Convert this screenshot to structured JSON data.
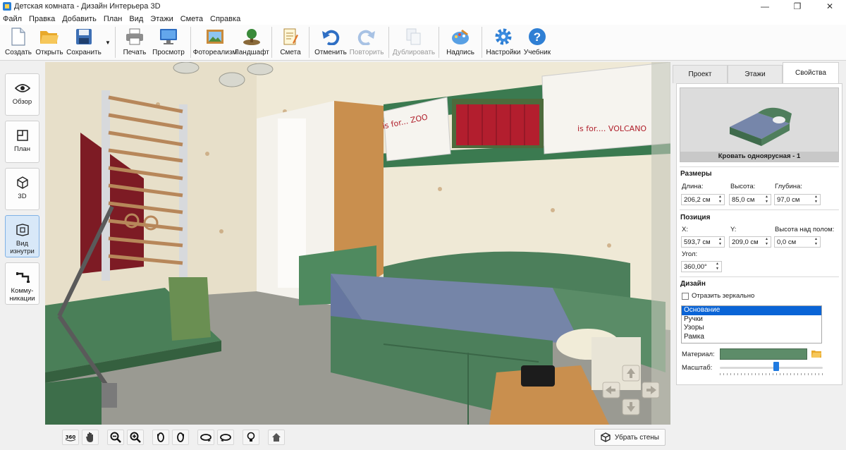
{
  "window": {
    "title": "Детская комната - Дизайн Интерьера 3D",
    "controls": [
      "minimize-icon",
      "maximize-icon",
      "close-icon"
    ]
  },
  "menu": [
    "Файл",
    "Правка",
    "Добавить",
    "План",
    "Вид",
    "Этажи",
    "Смета",
    "Справка"
  ],
  "toolbar": {
    "create": "Создать",
    "open": "Открыть",
    "save": "Сохранить",
    "print": "Печать",
    "preview": "Просмотр",
    "photorealism": "Фотореализм",
    "landscape": "Ландшафт",
    "estimate": "Смета",
    "undo": "Отменить",
    "redo": "Повторить",
    "duplicate": "Дублировать",
    "label": "Надпись",
    "settings": "Настройки",
    "tutorial": "Учебник"
  },
  "views": {
    "overview": "Обзор",
    "plan": "План",
    "threed": "3D",
    "inside_line1": "Вид",
    "inside_line2": "изнутри",
    "comm_line1": "Комму-",
    "comm_line2": "никации"
  },
  "scene_text": {
    "poster1": "is for... ZOO",
    "poster2": "is for.... VOLCANO"
  },
  "bottom": {
    "remove_walls": "Убрать стены",
    "icons": [
      "rotate-360-icon",
      "pan-hand-icon",
      "zoom-out-icon",
      "zoom-in-icon",
      "rotate-left-icon",
      "rotate-right-icon",
      "tilt-down-icon",
      "tilt-up-icon",
      "light-bulb-icon",
      "home-icon"
    ]
  },
  "tabs": [
    "Проект",
    "Этажи",
    "Свойства"
  ],
  "properties": {
    "object_name": "Кровать одноярусная - 1",
    "sizes_title": "Размеры",
    "length_label": "Длина:",
    "length": "206,2 см",
    "height_label": "Высота:",
    "height": "85,0 см",
    "depth_label": "Глубина:",
    "depth": "97,0 см",
    "position_title": "Позиция",
    "x_label": "X:",
    "x": "593,7 см",
    "y_label": "Y:",
    "y": "209,0 см",
    "elev_label": "Высота над полом:",
    "elev": "0,0 см",
    "angle_label": "Угол:",
    "angle": "360,00°",
    "design_title": "Дизайн",
    "mirror_label": "Отразить зеркально",
    "parts": [
      "Основание",
      "Ручки",
      "Узоры",
      "Рамка"
    ],
    "material_label": "Материал:",
    "scale_label": "Масштаб:",
    "material_color": "#5d8c69",
    "scale_level": 0.55
  }
}
